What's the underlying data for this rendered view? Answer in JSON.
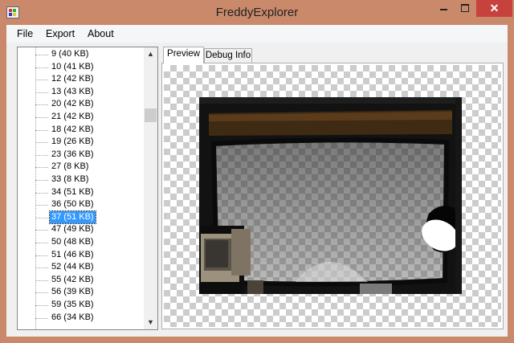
{
  "window": {
    "title": "FreddyExplorer",
    "close_glyph": "✕"
  },
  "menu": [
    "File",
    "Export",
    "About"
  ],
  "tree": {
    "items": [
      "9 (40 KB)",
      "10 (41 KB)",
      "12 (42 KB)",
      "13 (43 KB)",
      "20 (42 KB)",
      "21 (42 KB)",
      "18 (42 KB)",
      "19 (26 KB)",
      "23 (36 KB)",
      "27 (8 KB)",
      "33 (8 KB)",
      "34 (51 KB)",
      "36 (50 KB)",
      "37 (51 KB)",
      "47 (49 KB)",
      "50 (48 KB)",
      "51 (46 KB)",
      "52 (44 KB)",
      "55 (42 KB)",
      "56 (39 KB)",
      "59 (35 KB)",
      "66 (34 KB)"
    ],
    "selected": "37 (51 KB)",
    "scroll_up_glyph": "▲",
    "scroll_down_glyph": "▼"
  },
  "tabs": [
    "Preview",
    "Debug Info"
  ],
  "colors": {
    "titlebar": "#c9896a",
    "close_button": "#c7413d",
    "selection": "#3399ff"
  }
}
